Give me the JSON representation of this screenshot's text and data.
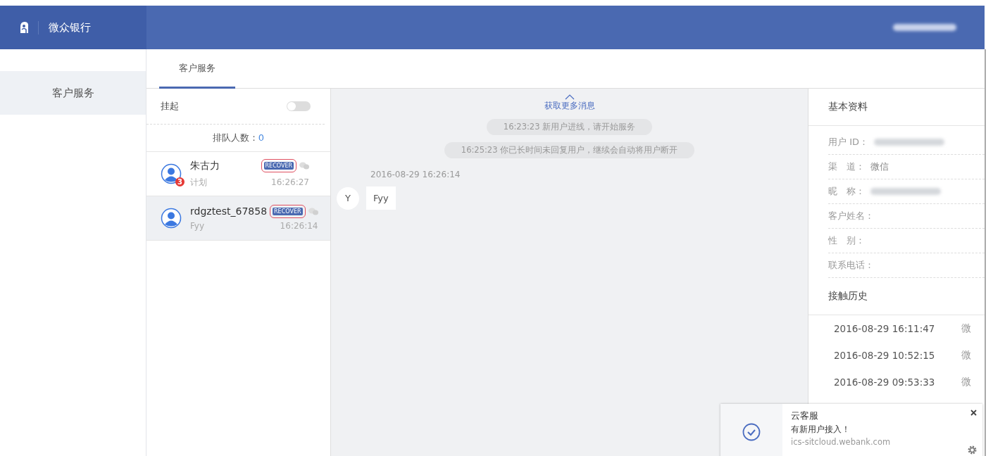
{
  "brand": {
    "name": "微众银行"
  },
  "sidebar": {
    "items": [
      {
        "label": "客户服务",
        "selected": true
      }
    ]
  },
  "tabs": [
    {
      "label": "客户服务",
      "selected": true
    }
  ],
  "queue": {
    "suspend_label": "挂起",
    "suspend_on": false,
    "count_label": "排队人数：",
    "count": "0"
  },
  "sessions": [
    {
      "name": "朱古力",
      "badge": "RECOVER",
      "unread": "3",
      "preview": "计划",
      "time": "16:26:27",
      "selected": false
    },
    {
      "name": "rdgztest_67858",
      "badge": "RECOVER",
      "preview": "Fyy",
      "time": "16:26:14",
      "selected": true
    }
  ],
  "chat": {
    "load_more": "获取更多消息",
    "system_messages": [
      "16:23:23 新用户进线，请开始服务",
      "16:25:23 你已长时间未回复用户，继续会自动将用户断开"
    ],
    "messages": [
      {
        "timestamp": "2016-08-29 16:26:14",
        "avatar": "Y",
        "text": "Fyy"
      }
    ]
  },
  "profile": {
    "title": "基本资料",
    "fields": [
      {
        "label": "用户 ID：",
        "value_redacted": true
      },
      {
        "label": "渠　道：",
        "value": "微信"
      },
      {
        "label": "昵　称：",
        "value_redacted": true
      },
      {
        "label": "客户姓名："
      },
      {
        "label": "性　别："
      },
      {
        "label": "联系电话："
      }
    ],
    "history_title": "接触历史",
    "history": [
      {
        "time": "2016-08-29 16:11:47",
        "channel": "微"
      },
      {
        "time": "2016-08-29 10:52:15",
        "channel": "微"
      },
      {
        "time": "2016-08-29 09:53:33",
        "channel": "微"
      }
    ]
  },
  "notification": {
    "title": "云客服",
    "message": "有新用户接入！",
    "source": "ics-sitcloud.webank.com"
  }
}
